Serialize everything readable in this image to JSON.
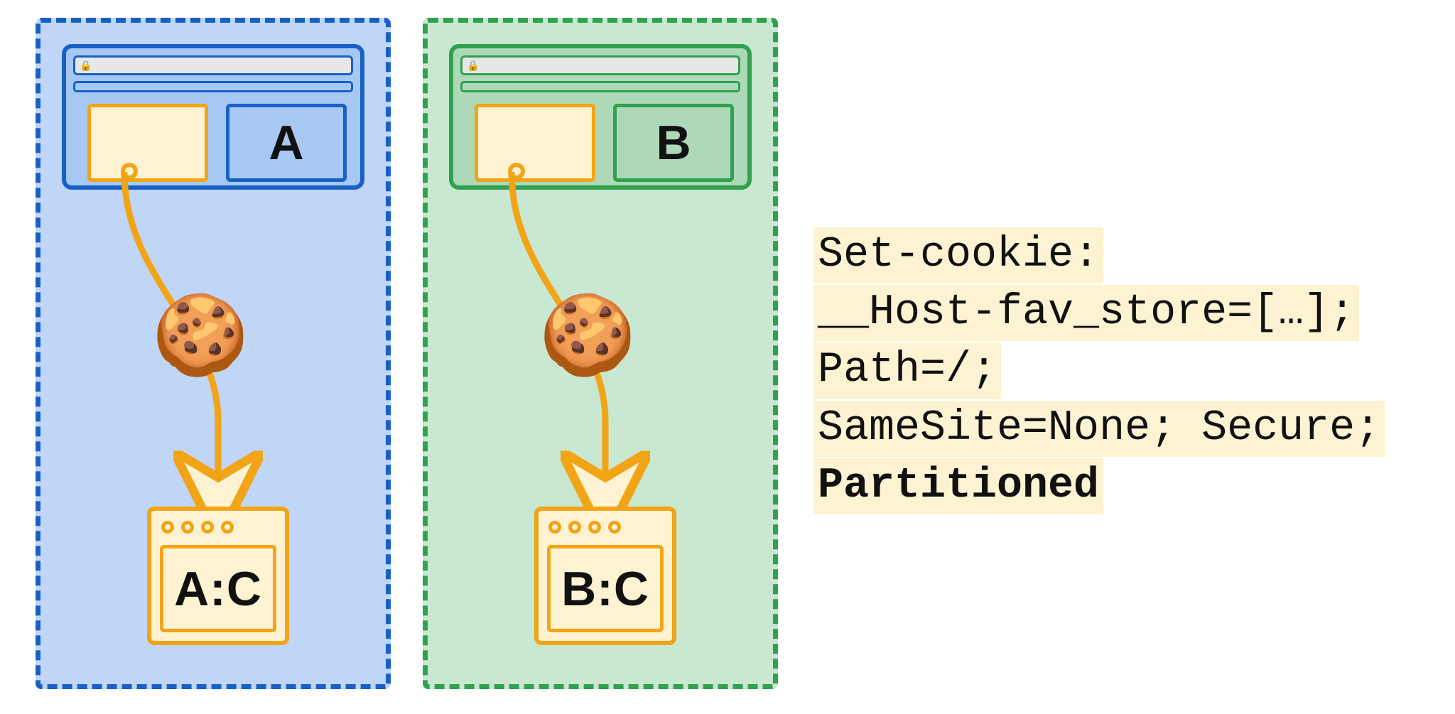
{
  "diagram": {
    "partitions": [
      {
        "id": "A",
        "site_label": "A",
        "jar_label": "A:C",
        "color": "blue"
      },
      {
        "id": "B",
        "site_label": "B",
        "jar_label": "B:C",
        "color": "green"
      }
    ],
    "cookie_icon": "🍪",
    "lock_icon": "🔒"
  },
  "code": {
    "lines": [
      "Set-cookie:",
      "__Host-fav_store=[…];",
      "Path=/;",
      "SameSite=None; Secure;",
      "Partitioned"
    ],
    "bold_line_index": 4
  },
  "colors": {
    "blue_border": "#1860c8",
    "blue_fill": "#c0d6f7",
    "green_border": "#2fa14f",
    "green_fill": "#c9e8d1",
    "amber_border": "#f2a417",
    "amber_fill": "#fdf3d3"
  }
}
